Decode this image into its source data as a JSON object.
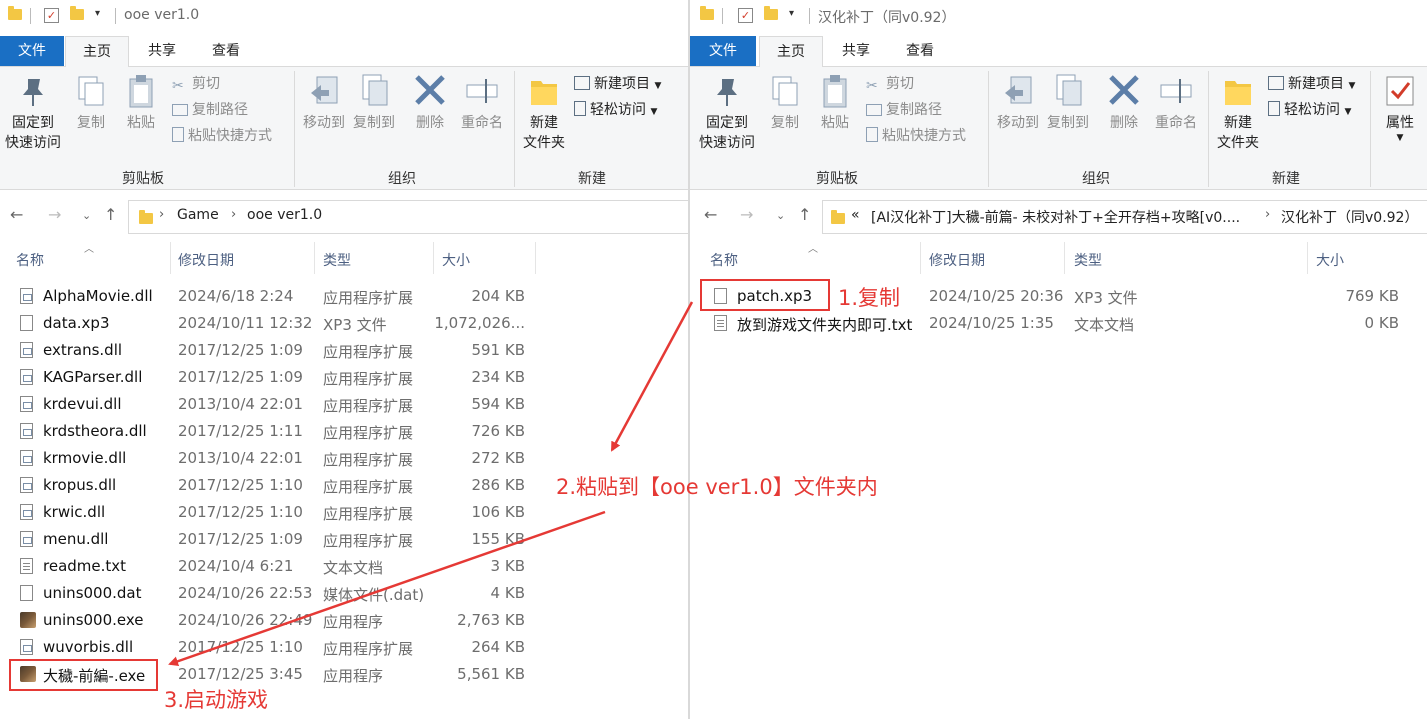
{
  "left": {
    "title": "ooe ver1.0",
    "tabs": [
      "文件",
      "主页",
      "共享",
      "查看"
    ],
    "ribbon": {
      "pin": "固定到\n快速访问",
      "copy": "复制",
      "paste": "粘贴",
      "cut": "剪切",
      "copy_path": "复制路径",
      "paste_shortcut": "粘贴快捷方式",
      "move_to": "移动到",
      "copy_to": "复制到",
      "delete": "删除",
      "rename": "重命名",
      "new_folder": "新建\n文件夹",
      "new_item": "新建项目",
      "easy_access": "轻松访问",
      "group_clipboard": "剪贴板",
      "group_organize": "组织",
      "group_new": "新建"
    },
    "breadcrumb": [
      "Game",
      "ooe ver1.0"
    ],
    "columns": {
      "name": "名称",
      "date": "修改日期",
      "type": "类型",
      "size": "大小"
    },
    "files": [
      {
        "name": "AlphaMovie.dll",
        "date": "2024/6/18 2:24",
        "type": "应用程序扩展",
        "size": "204 KB",
        "icon": "dll"
      },
      {
        "name": "data.xp3",
        "date": "2024/10/11 12:32",
        "type": "XP3 文件",
        "size": "1,072,026...",
        "icon": "file"
      },
      {
        "name": "extrans.dll",
        "date": "2017/12/25 1:09",
        "type": "应用程序扩展",
        "size": "591 KB",
        "icon": "dll"
      },
      {
        "name": "KAGParser.dll",
        "date": "2017/12/25 1:09",
        "type": "应用程序扩展",
        "size": "234 KB",
        "icon": "dll"
      },
      {
        "name": "krdevui.dll",
        "date": "2013/10/4 22:01",
        "type": "应用程序扩展",
        "size": "594 KB",
        "icon": "dll"
      },
      {
        "name": "krdstheora.dll",
        "date": "2017/12/25 1:11",
        "type": "应用程序扩展",
        "size": "726 KB",
        "icon": "dll"
      },
      {
        "name": "krmovie.dll",
        "date": "2013/10/4 22:01",
        "type": "应用程序扩展",
        "size": "272 KB",
        "icon": "dll"
      },
      {
        "name": "kropus.dll",
        "date": "2017/12/25 1:10",
        "type": "应用程序扩展",
        "size": "286 KB",
        "icon": "dll"
      },
      {
        "name": "krwic.dll",
        "date": "2017/12/25 1:10",
        "type": "应用程序扩展",
        "size": "106 KB",
        "icon": "dll"
      },
      {
        "name": "menu.dll",
        "date": "2017/12/25 1:09",
        "type": "应用程序扩展",
        "size": "155 KB",
        "icon": "dll"
      },
      {
        "name": "readme.txt",
        "date": "2024/10/4 6:21",
        "type": "文本文档",
        "size": "3 KB",
        "icon": "txt"
      },
      {
        "name": "unins000.dat",
        "date": "2024/10/26 22:53",
        "type": "媒体文件(.dat)",
        "size": "4 KB",
        "icon": "file"
      },
      {
        "name": "unins000.exe",
        "date": "2024/10/26 22:49",
        "type": "应用程序",
        "size": "2,763 KB",
        "icon": "exe"
      },
      {
        "name": "wuvorbis.dll",
        "date": "2017/12/25 1:10",
        "type": "应用程序扩展",
        "size": "264 KB",
        "icon": "dll"
      },
      {
        "name": "大穢-前編-.exe",
        "date": "2017/12/25 3:45",
        "type": "应用程序",
        "size": "5,561 KB",
        "icon": "exe"
      }
    ]
  },
  "right": {
    "title": "汉化补丁（同v0.92）",
    "tabs": [
      "文件",
      "主页",
      "共享",
      "查看"
    ],
    "ribbon": {
      "pin": "固定到\n快速访问",
      "copy": "复制",
      "paste": "粘贴",
      "cut": "剪切",
      "copy_path": "复制路径",
      "paste_shortcut": "粘贴快捷方式",
      "move_to": "移动到",
      "copy_to": "复制到",
      "delete": "删除",
      "rename": "重命名",
      "new_folder": "新建\n文件夹",
      "new_item": "新建项目",
      "easy_access": "轻松访问",
      "properties": "属性",
      "group_clipboard": "剪贴板",
      "group_organize": "组织",
      "group_new": "新建"
    },
    "breadcrumb": [
      "«",
      "[AI汉化补丁]大穢-前篇- 未校对补丁+全开存档+攻略[v0....",
      "汉化补丁（同v0.92）"
    ],
    "columns": {
      "name": "名称",
      "date": "修改日期",
      "type": "类型",
      "size": "大小"
    },
    "files": [
      {
        "name": "patch.xp3",
        "date": "2024/10/25 20:36",
        "type": "XP3 文件",
        "size": "769 KB",
        "icon": "file"
      },
      {
        "name": "放到游戏文件夹内即可.txt",
        "date": "2024/10/25 1:35",
        "type": "文本文档",
        "size": "0 KB",
        "icon": "txt"
      }
    ]
  },
  "annotations": {
    "step1": "1.复制",
    "step2": "2.粘贴到【ooe ver1.0】文件夹内",
    "step3": "3.启动游戏",
    "color": "#e53935"
  }
}
